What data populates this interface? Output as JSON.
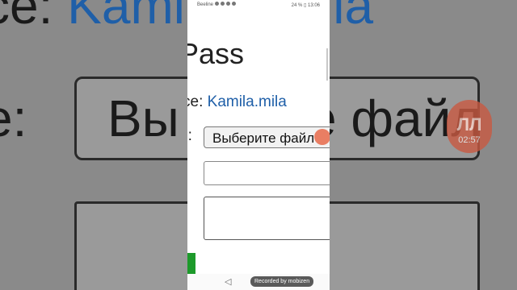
{
  "status_bar": {
    "carrier": "Beeline",
    "right": "24 % ▯ 13:06"
  },
  "page": {
    "title": "Pass",
    "service_label": "ce:",
    "service_value": "Kamila.mila",
    "file_label": "e:",
    "file_button": "Выберите файл"
  },
  "background": {
    "left_top_label": "ce:",
    "left_top_link": "Kamila",
    "left_mid_label": "e:",
    "left_mid_button": "Вы",
    "right_top_link": "ila",
    "right_mid_button": "е файл"
  },
  "overlay": {
    "recorded_label": "Recorded by mobizen",
    "badge_time": "02:57"
  },
  "colors": {
    "link": "#1f5fa8",
    "submit_green": "#1d9a2b",
    "badge": "#e86a4a"
  }
}
